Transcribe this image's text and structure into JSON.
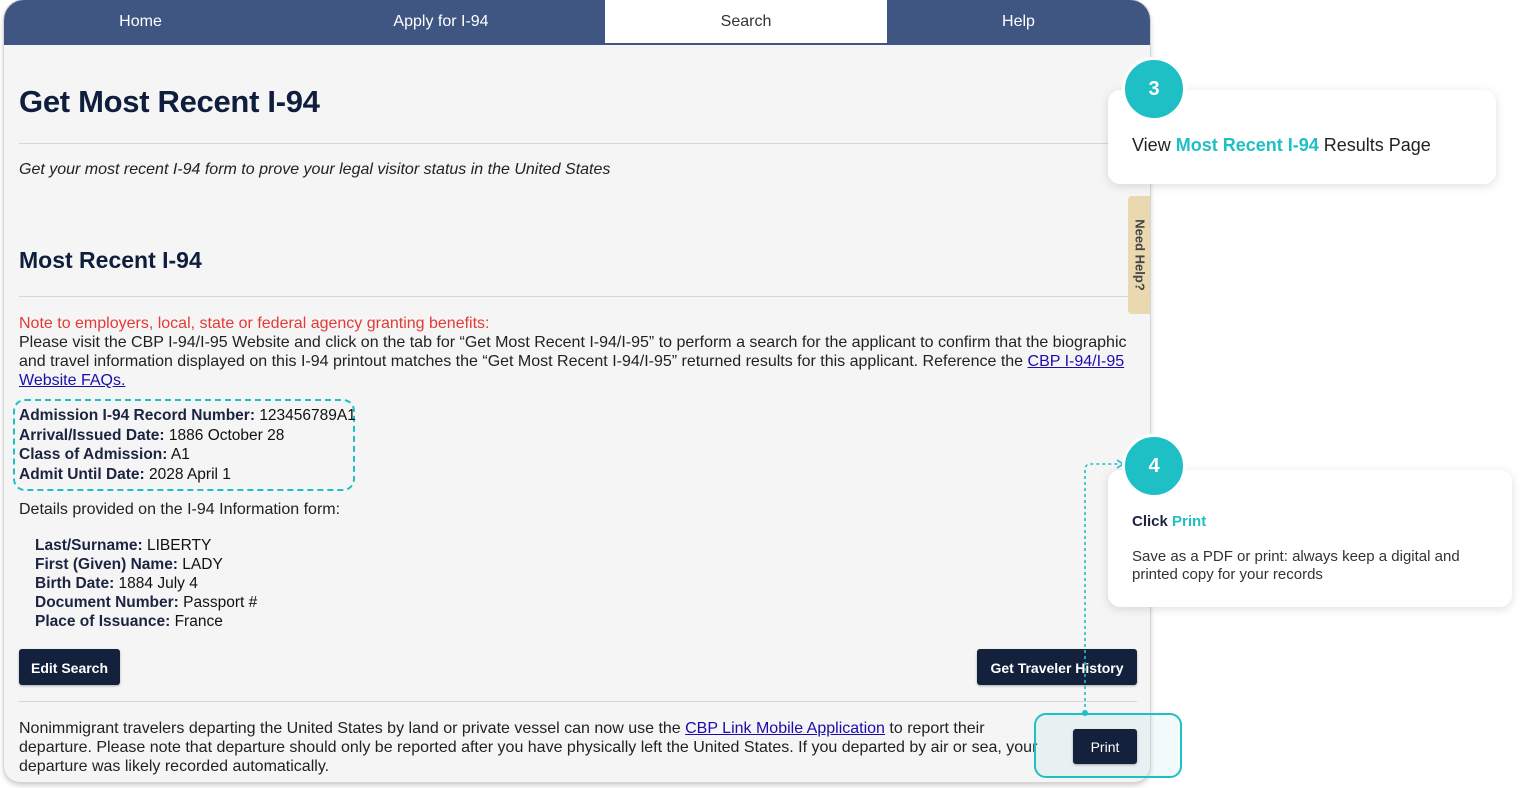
{
  "nav": {
    "tabs": [
      {
        "label": "Home"
      },
      {
        "label": "Apply for I-94"
      },
      {
        "label": "Search"
      },
      {
        "label": "Help"
      }
    ],
    "active": "Search"
  },
  "page": {
    "title": "Get Most Recent I-94",
    "subtitle": "Get your most recent I-94 form to prove your legal visitor status in the United States",
    "section_title": "Most Recent I-94"
  },
  "note": {
    "heading": "Note to employers, local, state or federal agency granting benefits:",
    "body": "Please visit the CBP I-94/I-95 Website and click on the tab for “Get Most Recent I-94/I-95” to perform a search for the applicant to confirm that the biographic and travel information displayed on this I-94 printout matches the “Get Most Recent I-94/I-95” returned results for this applicant. Reference the ",
    "link": "CBP I-94/I-95 Website FAQs."
  },
  "record": {
    "admission_number_label": "Admission I-94 Record Number:",
    "admission_number": "123456789A1",
    "arrival_label": "Arrival/Issued Date:",
    "arrival": "1886 October 28",
    "class_label": "Class of Admission:",
    "class": "A1",
    "admit_until_label": "Admit Until Date:",
    "admit_until": "2028 April 1"
  },
  "details": {
    "intro": "Details provided on the I-94 Information form:",
    "surname_label": "Last/Surname:",
    "surname": "LIBERTY",
    "given_label": "First (Given) Name:",
    "given": "LADY",
    "birth_label": "Birth Date:",
    "birth": "1884 July 4",
    "document_label": "Document Number:",
    "document": "Passport #",
    "issuance_label": "Place of Issuance:",
    "issuance": "France"
  },
  "buttons": {
    "edit_search": "Edit Search",
    "traveler_history": "Get Traveler History",
    "print": "Print"
  },
  "footer": {
    "before": "Nonimmigrant travelers departing the United States by land or private vessel can now use the ",
    "link": "CBP Link Mobile Application",
    "after": " to report their departure. Please note that departure should only be reported after you have physically left the United States. If you departed by air or sea, your departure was likely recorded automatically."
  },
  "need_help": "Need Help?",
  "callouts": {
    "step3": {
      "number": "3",
      "prefix": "View ",
      "highlight": "Most Recent I-94",
      "suffix": " Results Page"
    },
    "step4": {
      "number": "4",
      "title_prefix": "Click ",
      "title_highlight": "Print",
      "body": "Save as a PDF or print: always keep a digital and printed copy for your records"
    }
  },
  "colors": {
    "accent": "#1fbfc6",
    "nav": "#3f5682",
    "button": "#14213d",
    "note_heading": "#e53935"
  }
}
